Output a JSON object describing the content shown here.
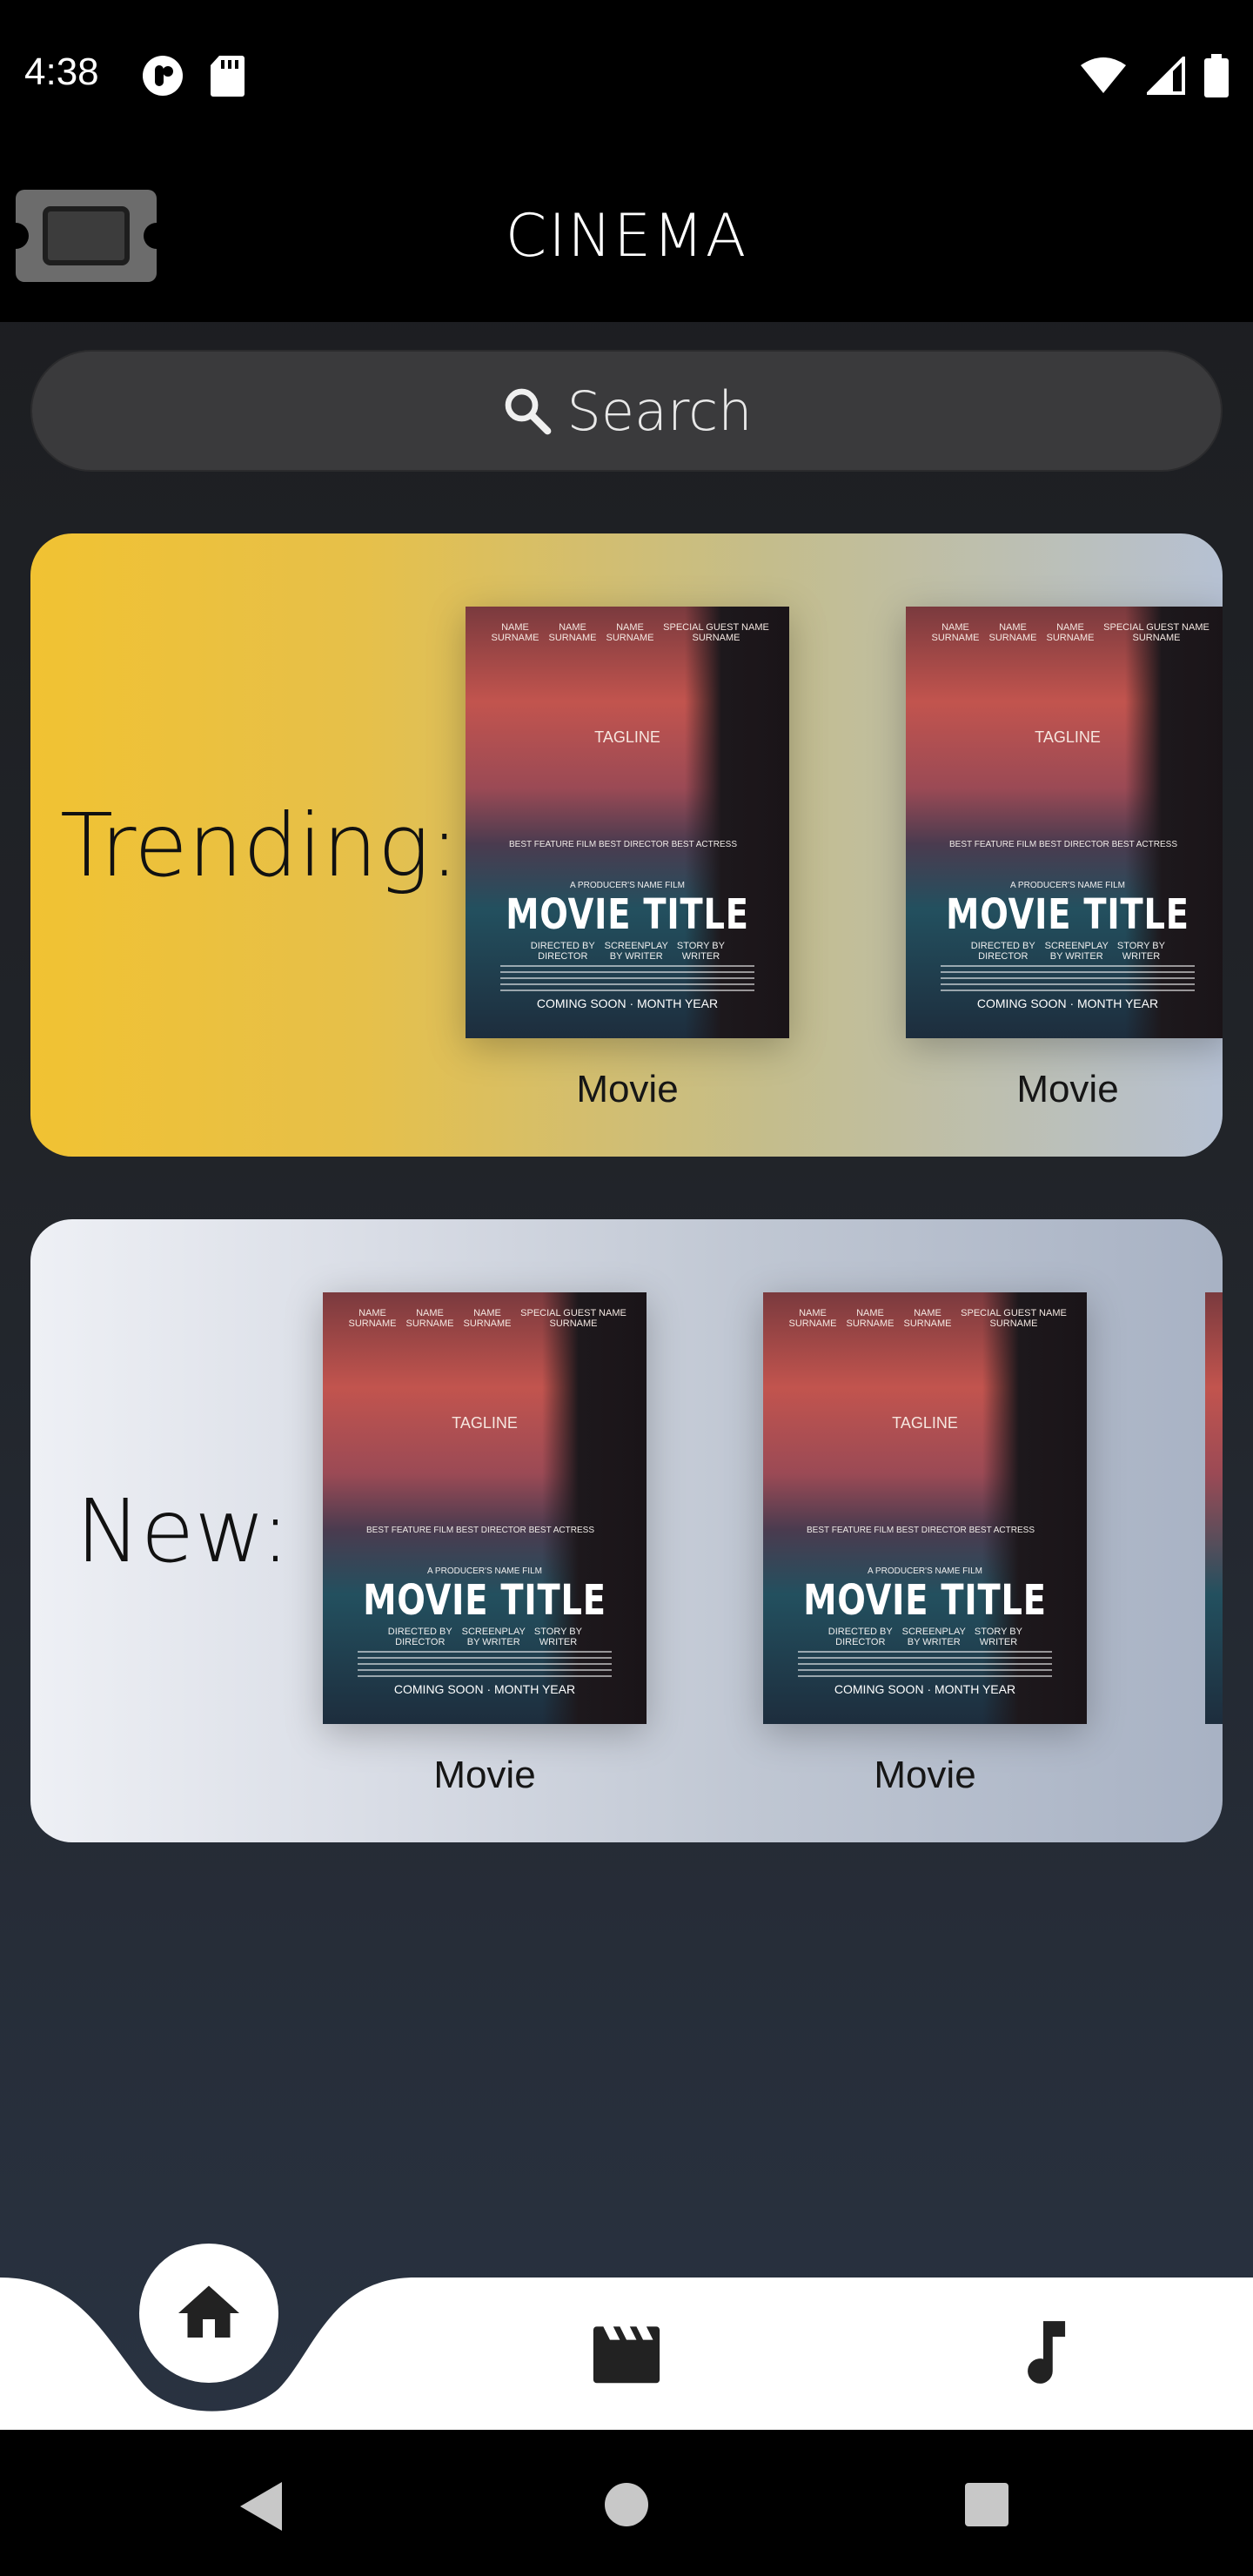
{
  "status_bar": {
    "time": "4:38"
  },
  "app_bar": {
    "title": "CINEMA"
  },
  "search": {
    "placeholder": "Search"
  },
  "trending": {
    "label": "Trending:",
    "movies": [
      {
        "caption": "Movie"
      },
      {
        "caption": "Movie"
      }
    ]
  },
  "new": {
    "label": "New:",
    "movies": [
      {
        "caption": "Movie"
      },
      {
        "caption": "Movie"
      }
    ]
  },
  "poster": {
    "credit_1": "NAME SURNAME",
    "credit_2": "NAME SURNAME",
    "credit_3": "NAME SURNAME",
    "credit_4": "SPECIAL GUEST NAME SURNAME",
    "tagline": "TAGLINE",
    "award_1": "BEST FEATURE FILM",
    "award_2": "BEST DIRECTOR",
    "award_3": "BEST ACTRESS",
    "producer": "A PRODUCER'S NAME FILM",
    "title": "MOVIE TITLE",
    "crew_1": "DIRECTED BY DIRECTOR",
    "crew_2": "SCREENPLAY BY WRITER",
    "crew_3": "STORY BY WRITER",
    "release": "COMING SOON · MONTH YEAR"
  },
  "bottom_nav": {
    "items": [
      {
        "icon": "home-icon",
        "active": true
      },
      {
        "icon": "movie-clapper-icon",
        "active": false
      },
      {
        "icon": "music-note-icon",
        "active": false
      }
    ]
  },
  "colors": {
    "trending_gradient_start": "#f1c232",
    "trending_gradient_end": "#b6c1d3",
    "new_gradient_start": "#eef0f5",
    "nav_background": "#ffffff",
    "bottom_dark": "#2a3444"
  }
}
